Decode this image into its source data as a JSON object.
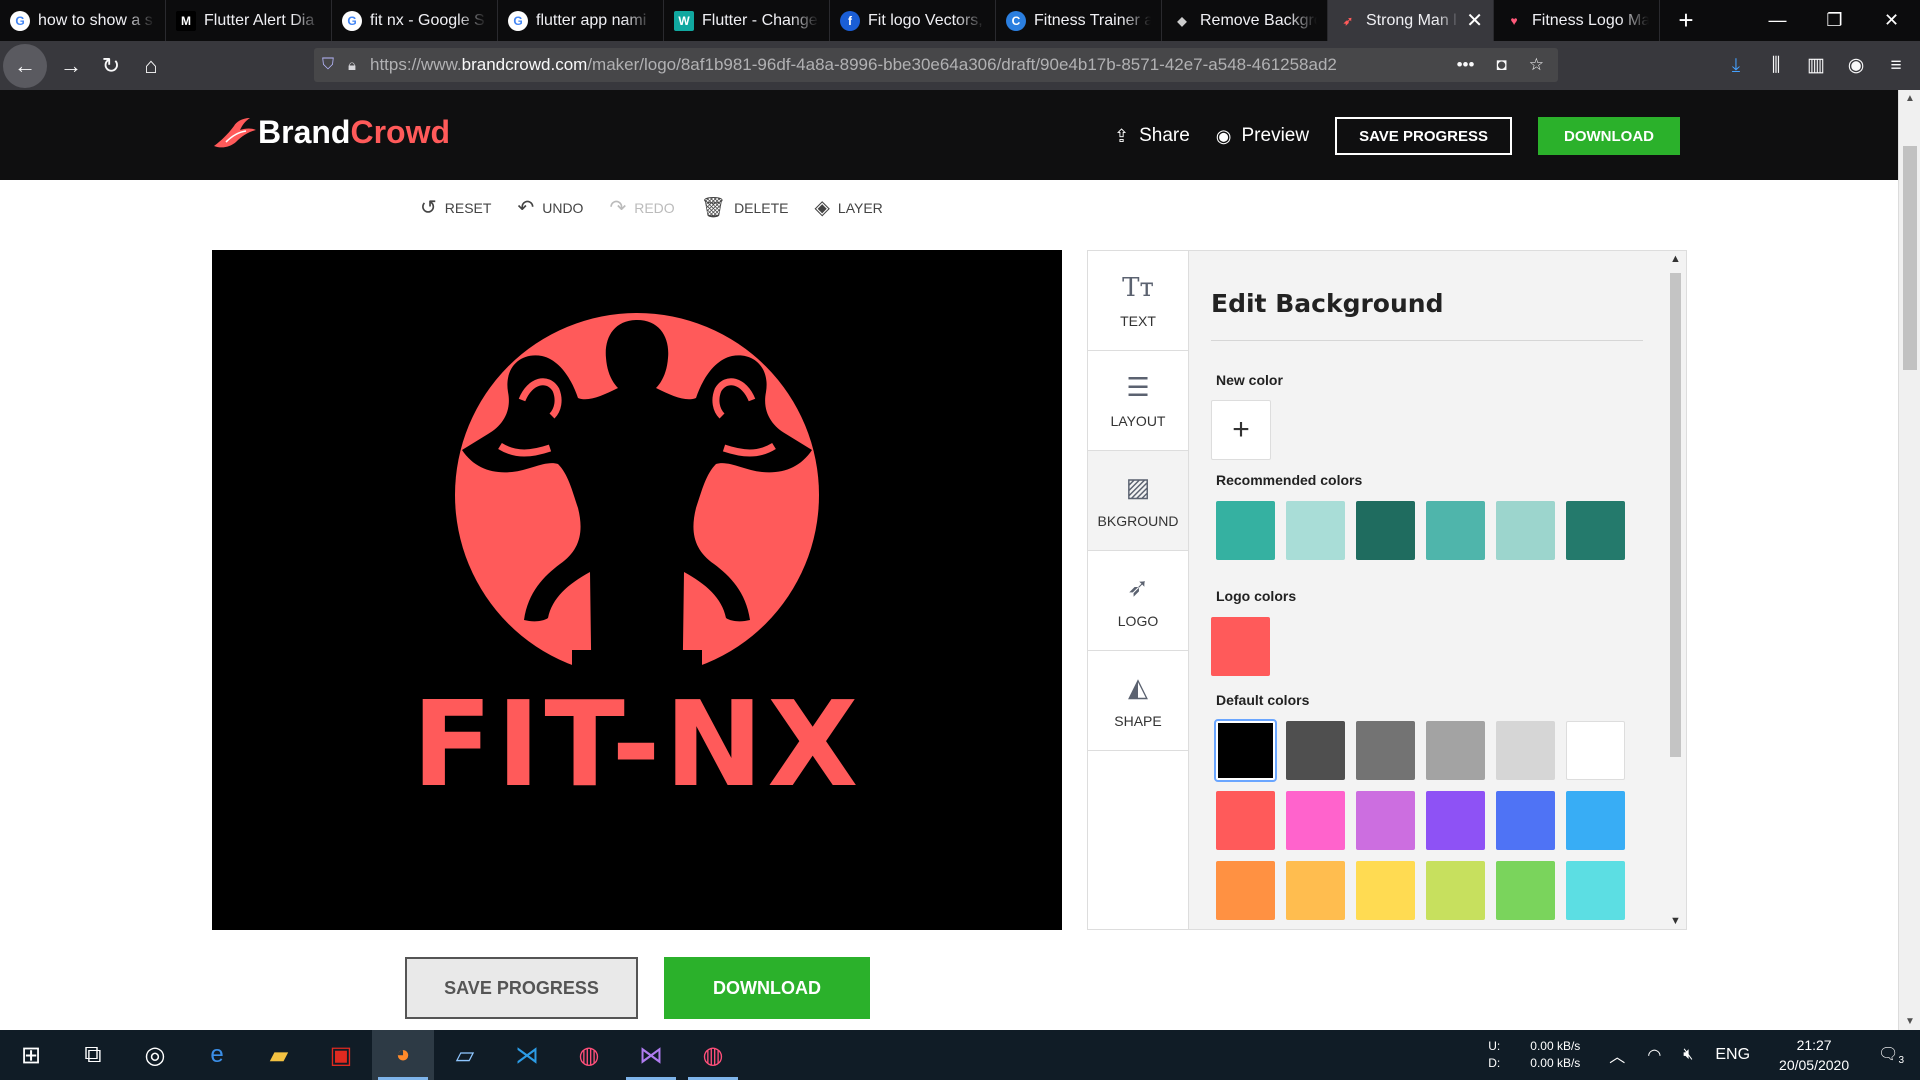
{
  "browser": {
    "tabs": [
      {
        "title": "how to show a s",
        "icon": "google-icon"
      },
      {
        "title": "Flutter Alert Dia",
        "icon": "medium-icon"
      },
      {
        "title": "fit nx - Google S",
        "icon": "google-icon"
      },
      {
        "title": "flutter app nami",
        "icon": "google-icon"
      },
      {
        "title": "Flutter - Change",
        "icon": "wordpress-icon"
      },
      {
        "title": "Fit logo Vectors,",
        "icon": "freepik-icon"
      },
      {
        "title": "Fitness Trainer a",
        "icon": "canva-icon"
      },
      {
        "title": "Remove Backgro",
        "icon": "removebg-icon"
      },
      {
        "title": "Strong Man l",
        "icon": "brandcrowd-icon",
        "active": true
      },
      {
        "title": "Fitness Logo Ma",
        "icon": "heart-logo-icon"
      }
    ],
    "url_prefix": "https://www.",
    "url_domain": "brandcrowd.com",
    "url_path": "/maker/logo/8af1b981-96df-4a8a-8996-bbe30e64a306/draft/90e4b17b-8571-42e7-a548-461258ad2"
  },
  "site": {
    "brand_first": "Brand",
    "brand_second": "Crowd",
    "share_label": "Share",
    "preview_label": "Preview",
    "save_progress_label": "SAVE PROGRESS",
    "download_label": "DOWNLOAD",
    "brand_red": "#ff5a5a",
    "download_green": "#2bb12b"
  },
  "toolbar": {
    "reset": "RESET",
    "undo": "UNDO",
    "redo": "REDO",
    "delete": "DELETE",
    "layer": "LAYER"
  },
  "canvas": {
    "logo_text": "FIT-NX",
    "background": "#000000",
    "logo_color": "#ff5a5a"
  },
  "panel": {
    "tabs": [
      "TEXT",
      "LAYOUT",
      "BKGROUND",
      "LOGO",
      "SHAPE"
    ],
    "active_tab": "BKGROUND",
    "title": "Edit Background",
    "new_color_label": "New color",
    "recommended_label": "Recommended colors",
    "recommended_colors": [
      "#35b1a1",
      "#a9ddd7",
      "#1f6c5f",
      "#4fb5ab",
      "#9cd5cd",
      "#247a6c"
    ],
    "logo_colors_label": "Logo colors",
    "logo_colors": [
      "#ff5a5a"
    ],
    "default_label": "Default colors",
    "default_colors": [
      [
        "#000000",
        "#4f4f4f",
        "#737373",
        "#a3a3a3",
        "#d6d6d6",
        "#ffffff"
      ],
      [
        "#ff5a5a",
        "#ff63cc",
        "#cc6ee0",
        "#8e52f5",
        "#4f73f5",
        "#38adf5"
      ],
      [
        "#ff9142",
        "#ffbd4f",
        "#ffdb52",
        "#c7e05e",
        "#7ad45c",
        "#5cdee3"
      ]
    ],
    "selected_default": "#000000"
  },
  "bottom": {
    "save_progress_label": "SAVE PROGRESS",
    "download_label": "DOWNLOAD"
  },
  "taskbar": {
    "net_up_label": "U:",
    "net_up": "0.00 kB/s",
    "net_down_label": "D:",
    "net_down": "0.00 kB/s",
    "lang": "ENG",
    "time": "21:27",
    "date": "20/05/2020",
    "notifications": "3"
  }
}
